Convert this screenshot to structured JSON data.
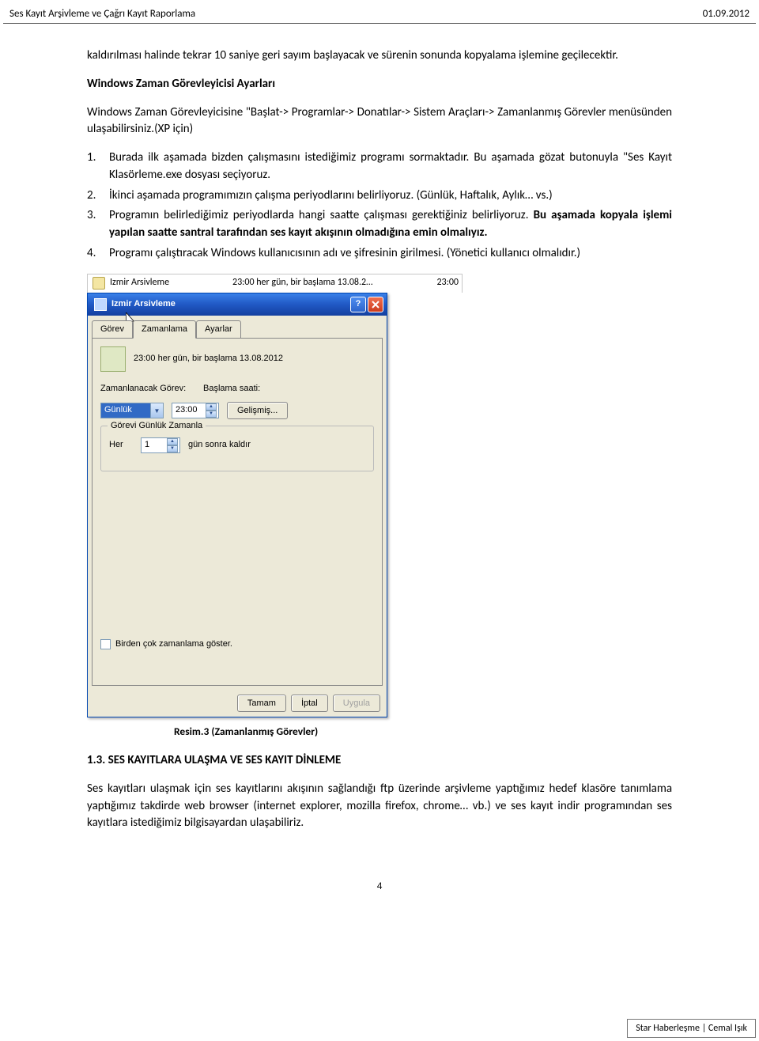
{
  "header": {
    "left": "Ses Kayıt Arşivleme ve Çağrı Kayıt Raporlama",
    "right": "01.09.2012"
  },
  "body": {
    "p1": "kaldırılması halinde tekrar 10 saniye geri sayım başlayacak ve sürenin sonunda kopyalama işlemine geçilecektir.",
    "h2": "Windows Zaman Görevleyicisi Ayarları",
    "p2": "Windows Zaman Görevleyicisine \"Başlat-> Programlar-> Donatılar-> Sistem Araçları-> Zamanlanmış Görevler menüsünden ulaşabilirsiniz.(XP için)",
    "steps": [
      "Burada ilk aşamada bizden çalışmasını istediğimiz programı sormaktadır. Bu aşamada gözat butonuyla \"Ses Kayıt Klasörleme.exe dosyası seçiyoruz.",
      "İkinci aşamada programımızın çalışma periyodlarını belirliyoruz. (Günlük, Haftalık, Aylık… vs.)",
      "Programın belirlediğimiz periyodlarda hangi saatte çalışması gerektiğiniz belirliyoruz. Bu aşamada kopyala işlemi yapılan saatte santral tarafından ses kayıt akışının olmadığına emin olmalıyız.",
      "Programı çalıştıracak Windows kullanıcısının adı ve şifresinin girilmesi. (Yönetici kullanıcı olmalıdır.)"
    ],
    "step3_bold_start": "Bu aşamada kopyala işlemi yapılan saatte santral tarafından ses kayıt akışının olmadığına emin olmalıyız.",
    "caption": "Resim.3 (Zamanlanmış Görevler)",
    "section13": "1.3. SES KAYITLARA ULAŞMA VE SES KAYIT DİNLEME",
    "p3": "Ses kayıtları ulaşmak için ses kayıtlarını akışının sağlandığı ftp üzerinde arşivleme yaptığımız hedef klasöre tanımlama yaptığımız takdirde web browser (internet explorer, mozilla firefox, chrome… vb.) ve ses kayıt indir programından ses kayıtlara istediğimiz bilgisayardan ulaşabiliriz."
  },
  "task_row": {
    "name": "Izmir Arsivleme",
    "time": "23:00 her gün, bir başlama 13.08.2…",
    "time2": "23:00"
  },
  "dialog": {
    "title": "Izmir Arsivleme",
    "tabs": {
      "gorev": "Görev",
      "zamanlama": "Zamanlama",
      "ayarlar": "Ayarlar"
    },
    "sched_desc": "23:00 her gün, bir başlama 13.08.2012",
    "lbl_gorev": "Zamanlanacak Görev:",
    "lbl_saat": "Başlama saati:",
    "sel_value": "Günlük",
    "time_value": "23:00",
    "btn_advanced": "Gelişmiş...",
    "legend": "Görevi Günlük Zamanla",
    "lbl_her": "Her",
    "days_value": "1",
    "lbl_sonra": "gün sonra kaldır",
    "chk_label": "Birden çok zamanlama göster.",
    "btn_ok": "Tamam",
    "btn_cancel": "İptal",
    "btn_apply": "Uygula"
  },
  "page_number": "4",
  "footer": "Star Haberleşme | Cemal Işık"
}
